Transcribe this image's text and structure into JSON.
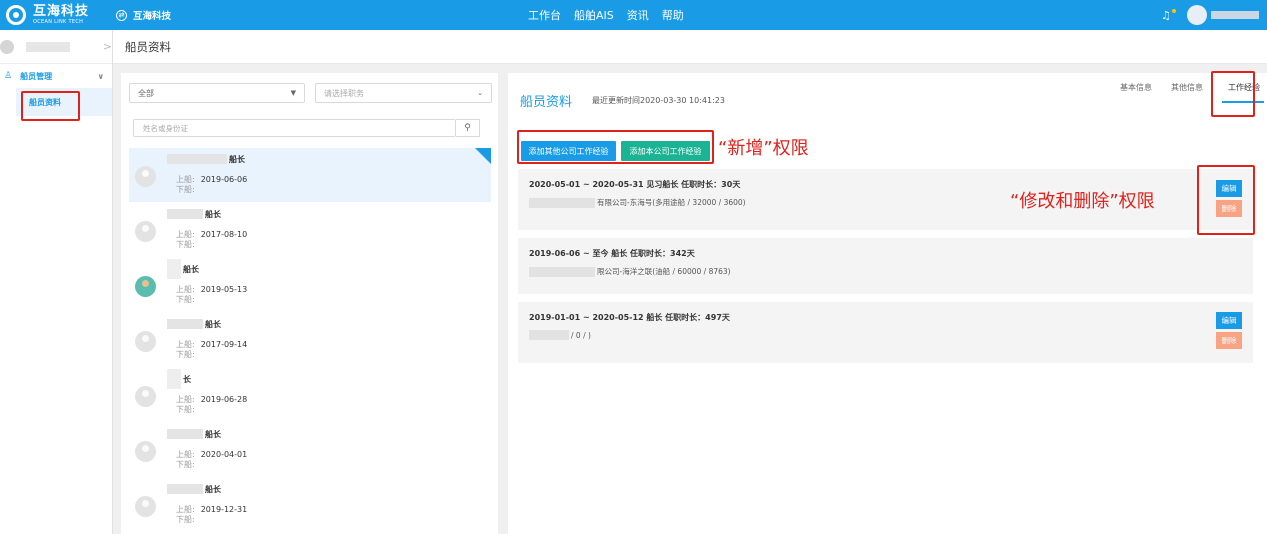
{
  "topbar": {
    "logo_cn": "互海科技",
    "logo_en": "OCEAN LINK TECH",
    "org_name": "互海科技",
    "nav": [
      "工作台",
      "船舶AIS",
      "资讯",
      "帮助"
    ]
  },
  "sidebar": {
    "group_label": "船员管理",
    "item_label": "船员资料"
  },
  "breadcrumb": "船员资料",
  "filters": {
    "category_value": "全部",
    "position_placeholder": "请选择职务",
    "search_placeholder": "姓名或身份证"
  },
  "crew_list": [
    {
      "rank": "船长",
      "board_label": "上船:",
      "board_date": "2019-06-06",
      "leave_label": "下船:"
    },
    {
      "rank": "船长",
      "board_label": "上船:",
      "board_date": "2017-08-10",
      "leave_label": "下船:"
    },
    {
      "rank": "船长",
      "board_label": "上船:",
      "board_date": "2019-05-13",
      "leave_label": "下船:"
    },
    {
      "rank": "船长",
      "board_label": "上船:",
      "board_date": "2017-09-14",
      "leave_label": "下船:"
    },
    {
      "rank": "长",
      "board_label": "上船:",
      "board_date": "2019-06-28",
      "leave_label": "下船:"
    },
    {
      "rank": "船长",
      "board_label": "上船:",
      "board_date": "2020-04-01",
      "leave_label": "下船:"
    },
    {
      "rank": "船长",
      "board_label": "上船:",
      "board_date": "2019-12-31",
      "leave_label": "下船:"
    }
  ],
  "detail": {
    "title": "船员资料",
    "updated": "最近更新时间2020-03-30 10:41:23",
    "tabs": [
      "基本信息",
      "其他信息",
      "工作经验"
    ],
    "add_other_label": "添加其他公司工作经验",
    "add_own_label": "添加本公司工作经验",
    "annotation_add": "“新增”权限",
    "annotation_edit": "“修改和删除”权限",
    "edit_label": "编辑",
    "delete_label": "删除",
    "experiences": [
      {
        "header": "2020-05-01 ~ 2020-05-31  见习船长   任职时长：30天",
        "company": "有限公司-东海号(多用途船 / 32000 / 3600)"
      },
      {
        "header": "2019-06-06 ~ 至今  船长   任职时长：342天",
        "company": "限公司-海洋之联(油船 / 60000 / 8763)"
      },
      {
        "header": "2019-01-01 ~ 2020-05-12  船长   任职时长：497天",
        "company": "/ 0 / )"
      }
    ]
  },
  "colors": {
    "primary": "#1a9be6",
    "green": "#1ab394",
    "delete": "#f7a384",
    "annotation": "#e0221c"
  }
}
